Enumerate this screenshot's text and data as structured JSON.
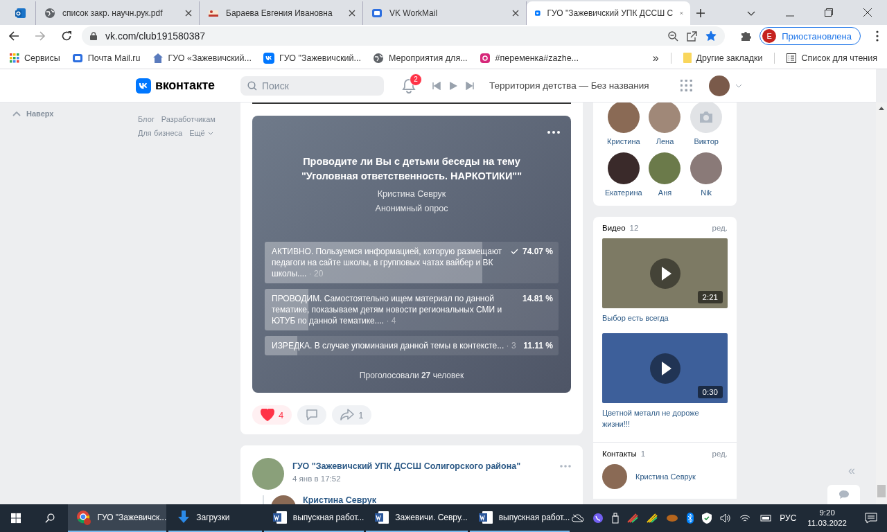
{
  "browser": {
    "tabs": [
      {
        "kind": "outlook",
        "selected": false
      },
      {
        "kind": "globe",
        "title": "список закр. научн.рук.pdf",
        "selected": false
      },
      {
        "kind": "raw",
        "title": "Бараева Евгения Ивановна",
        "selected": false
      },
      {
        "kind": "mail",
        "title": "VK WorkMail",
        "selected": false
      },
      {
        "kind": "vk",
        "title": "ГУО \"Зажевичский УПК ДССШ С",
        "selected": true
      }
    ],
    "url": "vk.com/club191580387",
    "bookmarked": true,
    "profile": {
      "initial": "Е",
      "label": "Приостановлена"
    },
    "bookmarks": [
      {
        "kind": "apps",
        "label": "Сервисы"
      },
      {
        "kind": "mail",
        "label": "Почта Mail.ru"
      },
      {
        "kind": "shield",
        "label": "ГУО «Зажевичский..."
      },
      {
        "kind": "vk",
        "label": "ГУО \"Зажевичский..."
      },
      {
        "kind": "globe",
        "label": "Мероприятия для..."
      },
      {
        "kind": "insta",
        "label": "#переменка#zazhe..."
      }
    ],
    "more": "»",
    "other_bookmarks": "Другие закладки",
    "reading_list": "Список для чтения"
  },
  "header": {
    "logo": "вконтакте",
    "search": {
      "placeholder": "Поиск"
    },
    "notifications": "2",
    "track": "Территория детства — Без названия"
  },
  "left_nav": {
    "up": "Наверх",
    "links": [
      "Блог",
      "Разработчикам",
      "Для бизнеса",
      "Ещё"
    ]
  },
  "poll": {
    "title": "Проводите ли Вы с детьми беседы на тему \"Уголовная ответственность. НАРКОТИКИ\"\"",
    "author": "Кристина Севрук",
    "type": "Анонимный опрос",
    "options": [
      {
        "label": "АКТИВНО. Пользуемся информацией, которую размещают педагоги на сайте школы, в групповых чатах вайбер и ВК школы....",
        "count": "· 20",
        "percent": "74.07 %",
        "level": 0.7407,
        "checked": true
      },
      {
        "label": "ПРОВОДИМ. Самостоятельно ищем материал по данной тематике, показываем детям новости региональных СМИ и ЮТУБ по данной тематике....",
        "count": "· 4",
        "percent": "14.81 %",
        "level": 0.1481,
        "checked": false
      },
      {
        "label": "ИЗРЕДКА. В случае упоминания данной темы в контексте...",
        "count": "· 3",
        "percent": "11.11 %",
        "level": 0.1111,
        "checked": false
      }
    ],
    "total": "Проголосовали **27** человек"
  },
  "reactions": {
    "likes": "4",
    "liked": true,
    "shares": "1"
  },
  "next_post": {
    "author": "ГУО \"Зажевичский УПК ДССШ Солигорского района\"",
    "date": "4 янв в 17:52",
    "comment_author": "Кристина Севрук"
  },
  "friends": [
    {
      "name": "Кристина",
      "kind": "photo"
    },
    {
      "name": "Лена",
      "kind": "photo"
    },
    {
      "name": "Виктор",
      "kind": "none"
    },
    {
      "name": "Екатерина",
      "kind": "photo"
    },
    {
      "name": "Аня",
      "kind": "photo"
    },
    {
      "name": "Nik",
      "kind": "photo"
    }
  ],
  "videos": {
    "title": "Видео",
    "count": "12",
    "edit": "ред.",
    "items": [
      {
        "duration": "2:21",
        "title": "Выбор есть всегда"
      },
      {
        "duration": "0:30",
        "title": "Цветной металл не дороже жизни!!!"
      }
    ]
  },
  "contacts": {
    "title": "Контакты",
    "count": "1",
    "edit": "ред.",
    "items": [
      {
        "name": "Кристина Севрук"
      }
    ]
  },
  "collapse": "«",
  "taskbar": {
    "apps": [
      {
        "kind": "chrome",
        "label": "ГУО \"Зажевичск...",
        "active": true
      },
      {
        "kind": "download",
        "label": "Загрузки",
        "active": false
      },
      {
        "kind": "word",
        "label": "выпускная работ...",
        "active": false
      },
      {
        "kind": "word",
        "label": "Зажевичи. Севру...",
        "active": false
      },
      {
        "kind": "word",
        "label": "выпускная работ...",
        "active": false
      }
    ],
    "language": "РУС",
    "time": "9:20",
    "date": "11.03.2022"
  }
}
